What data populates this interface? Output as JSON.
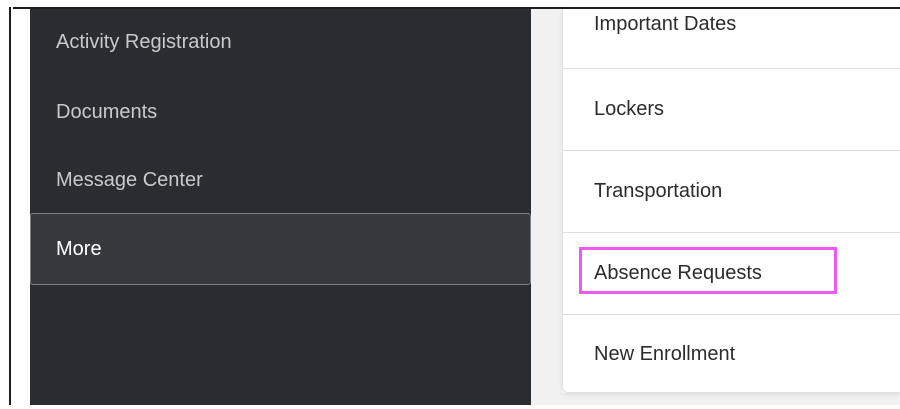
{
  "sidebar": {
    "items": [
      {
        "label": "Activity Registration"
      },
      {
        "label": "Documents"
      },
      {
        "label": "Message Center"
      },
      {
        "label": "More"
      }
    ]
  },
  "more_menu": {
    "items": [
      {
        "label": "Important Dates"
      },
      {
        "label": "Lockers"
      },
      {
        "label": "Transportation"
      },
      {
        "label": "Absence Requests"
      },
      {
        "label": "New Enrollment"
      }
    ],
    "highlighted_item": "Absence Requests",
    "highlight_color": "#ef59ef"
  },
  "colors": {
    "sidebar_bg": "#292c30",
    "sidebar_active_bg": "#35393e",
    "sidebar_text": "#c9cacc",
    "menu_text": "#2c2c2c"
  }
}
